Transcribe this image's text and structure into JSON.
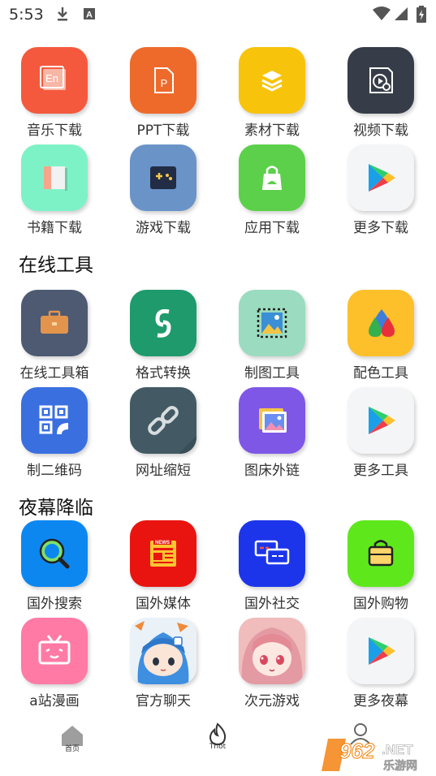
{
  "status_bar": {
    "time": "5:53",
    "left_icons": [
      "download-icon",
      "a-badge-icon"
    ],
    "right_icons": [
      "wifi-icon",
      "signal-icon",
      "battery-icon"
    ]
  },
  "top_group": {
    "items": [
      {
        "label": "音乐下载",
        "icon": "music-en-icon",
        "color": "#f4593d"
      },
      {
        "label": "PPT下载",
        "icon": "ppt-icon",
        "color": "#ee6a2b"
      },
      {
        "label": "素材下载",
        "icon": "layers-icon",
        "color": "#f8c30b"
      },
      {
        "label": "视频下载",
        "icon": "video-icon",
        "color": "#373d48"
      },
      {
        "label": "书籍下载",
        "icon": "book-icon",
        "color": "#7ef2c7"
      },
      {
        "label": "游戏下载",
        "icon": "gamepad-icon",
        "color": "#6a93c8"
      },
      {
        "label": "应用下载",
        "icon": "shopping-bag-icon",
        "color": "#5cd04b"
      },
      {
        "label": "更多下载",
        "icon": "play-store-icon",
        "color": "#f4f5f6"
      }
    ]
  },
  "tools_section": {
    "title": "在线工具",
    "items": [
      {
        "label": "在线工具箱",
        "icon": "toolbox-icon",
        "color": "#4d5a72"
      },
      {
        "label": "格式转换",
        "icon": "convert-icon",
        "color": "#1f9a6c"
      },
      {
        "label": "制图工具",
        "icon": "image-frame-icon",
        "color": "#9bdcc0"
      },
      {
        "label": "配色工具",
        "icon": "color-drops-icon",
        "color": "#fdc02b"
      },
      {
        "label": "制二维码",
        "icon": "qrcode-icon",
        "color": "#3a6fe0"
      },
      {
        "label": "网址缩短",
        "icon": "link-icon",
        "color": "#435a64"
      },
      {
        "label": "图床外链",
        "icon": "gallery-icon",
        "color": "#7e57e6"
      },
      {
        "label": "更多工具",
        "icon": "play-store-icon",
        "color": "#f4f5f6"
      }
    ]
  },
  "night_section": {
    "title": "夜幕降临",
    "items": [
      {
        "label": "国外搜索",
        "icon": "search-icon",
        "color": "#0d87f0"
      },
      {
        "label": "国外媒体",
        "icon": "news-icon",
        "color": "#e91410"
      },
      {
        "label": "国外社交",
        "icon": "chat-icon",
        "color": "#1c35ea"
      },
      {
        "label": "国外购物",
        "icon": "bag-icon",
        "color": "#5ee81c"
      },
      {
        "label": "a站漫画",
        "icon": "tv-icon",
        "color": "#ff7aa5"
      },
      {
        "label": "官方聊天",
        "icon": "anime-avatar-icon",
        "color": "#eaf2f8"
      },
      {
        "label": "次元游戏",
        "icon": "anime-girl-icon",
        "color": "#f3c3c3"
      },
      {
        "label": "更多夜幕",
        "icon": "play-store-icon",
        "color": "#f4f5f6"
      }
    ]
  },
  "bottom_nav": {
    "home_label": "首页",
    "hot_label": "Thot",
    "profile_label": ""
  },
  "watermark": {
    "brand": "962",
    "suffix": ".NET",
    "subtitle": "乐游网"
  }
}
